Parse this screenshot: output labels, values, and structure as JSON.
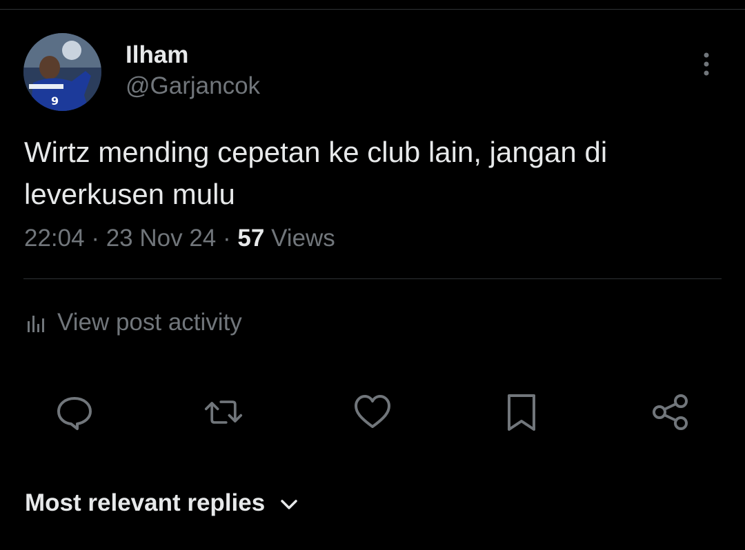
{
  "post": {
    "display_name": "Ilham",
    "handle": "@Garjancok",
    "text": "Wirtz mending cepetan ke club lain, jangan di leverkusen mulu",
    "time": "22:04",
    "separator": "·",
    "date": "23 Nov 24",
    "views_count": "57",
    "views_label": "Views"
  },
  "activity": {
    "label": "View post activity",
    "icon": "bar-chart-icon"
  },
  "actions": {
    "reply_icon": "reply-icon",
    "repost_icon": "repost-icon",
    "like_icon": "heart-icon",
    "bookmark_icon": "bookmark-icon",
    "share_icon": "share-icon"
  },
  "replies": {
    "sort_label": "Most relevant replies"
  },
  "colors": {
    "background": "#000000",
    "primary_text": "#e7e9ea",
    "secondary_text": "#71767b",
    "divider": "#2f3336"
  }
}
